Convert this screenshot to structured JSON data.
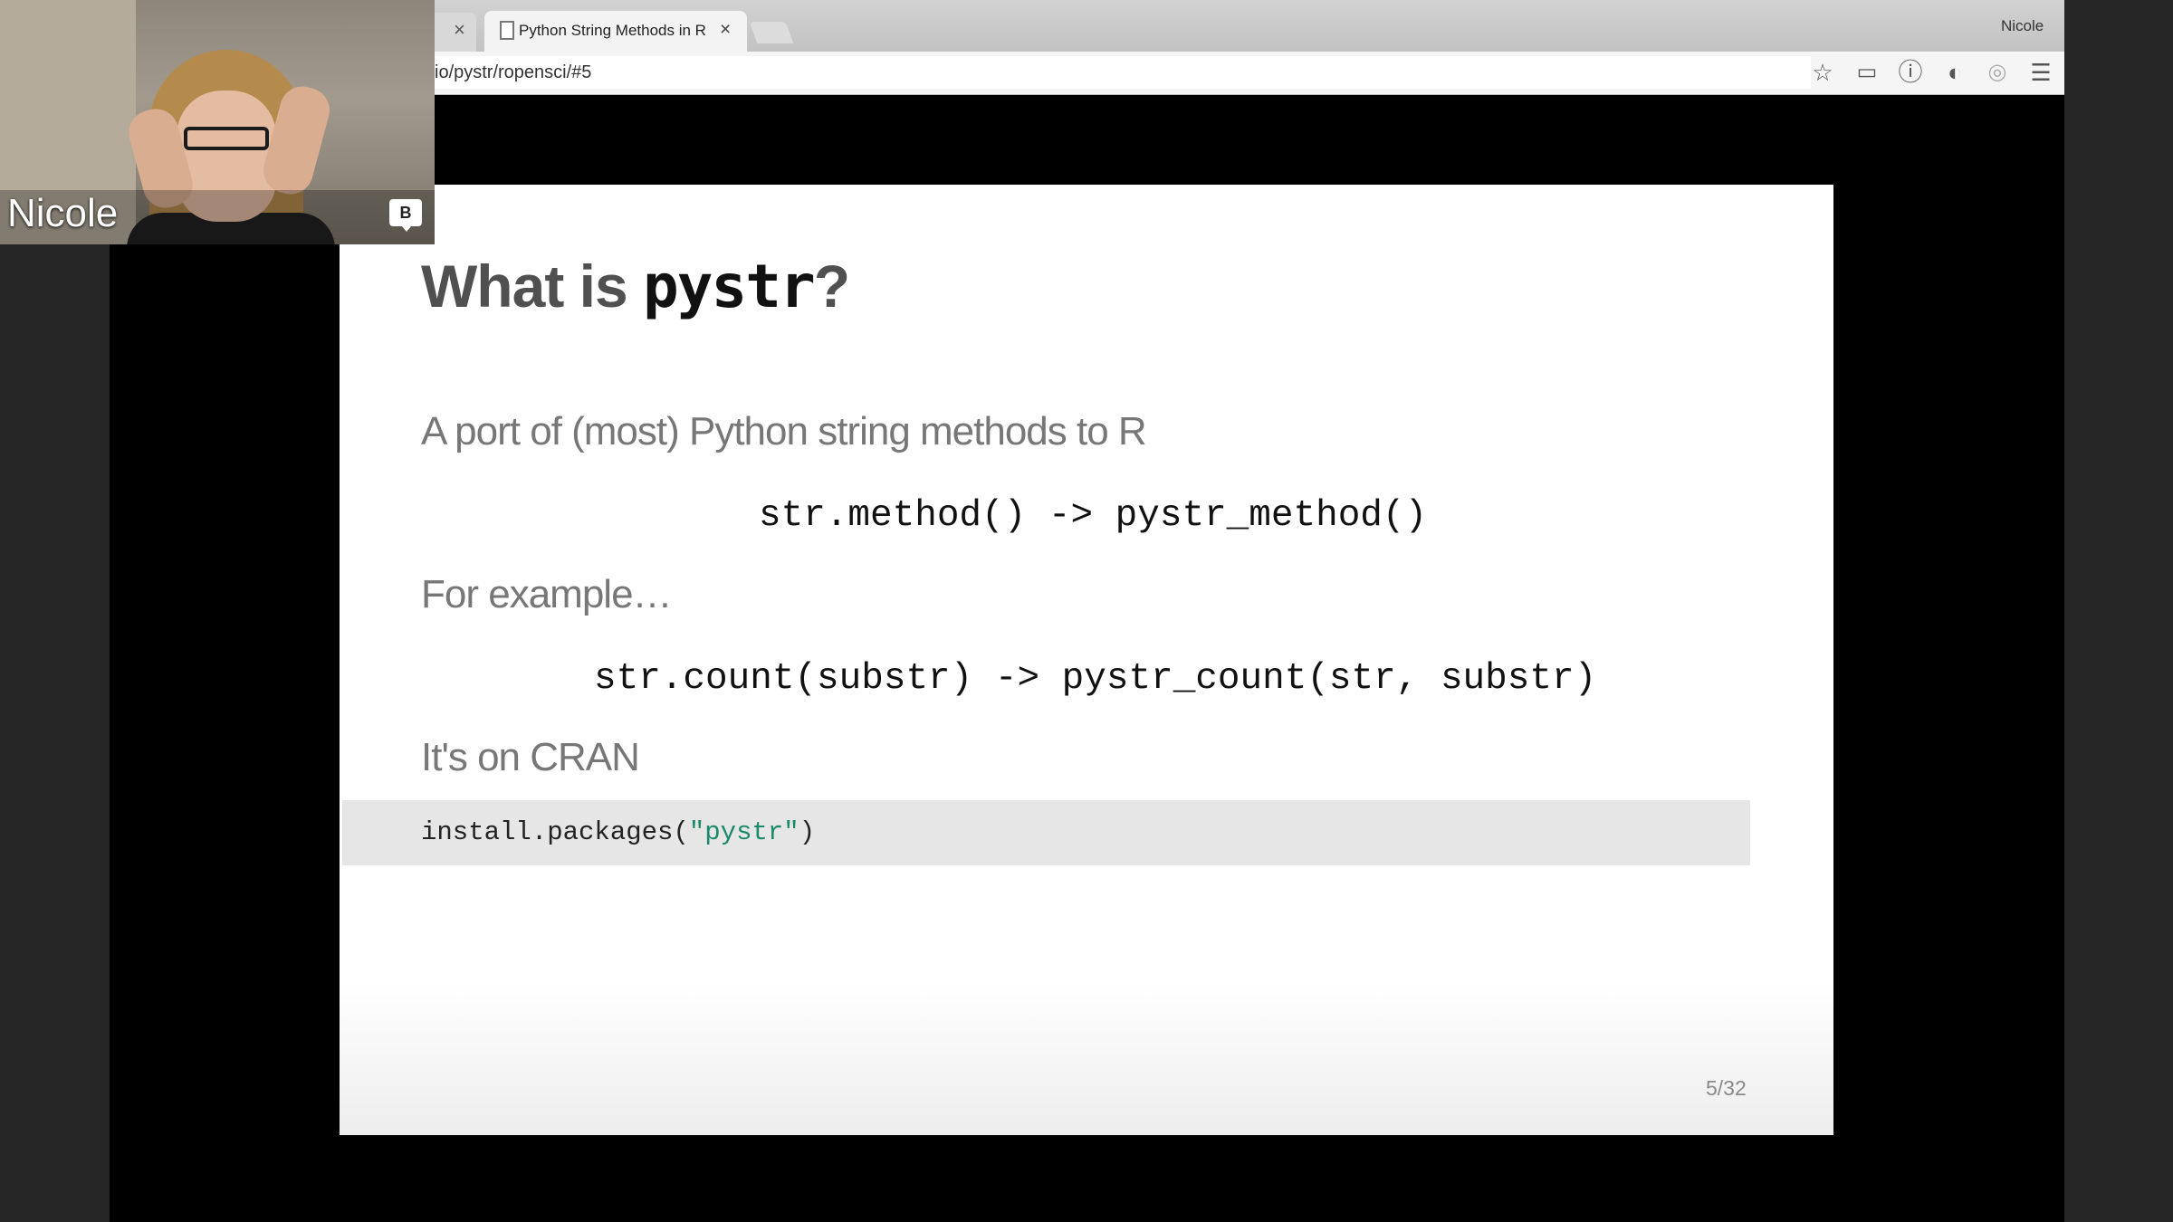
{
  "webcam": {
    "participant_name": "Nicole",
    "badge": "B"
  },
  "browser": {
    "active_tab_title": "Python String Methods in R",
    "profile_name": "Nicole",
    "url": "io/pystr/ropensci/#5",
    "icons": [
      "star-icon",
      "cast-icon",
      "info-icon",
      "extension-icon",
      "camera-icon",
      "menu-icon"
    ]
  },
  "slide": {
    "title_prefix": "What is ",
    "title_code": "pystr",
    "title_suffix": "?",
    "line1": "A port of (most) Python string methods to R",
    "code1": "str.method() -> pystr_method()",
    "line2": "For example…",
    "code2": "str.count(substr) -> pystr_count(str, substr)",
    "line3": "It's on CRAN",
    "install_fn": "install.packages(",
    "install_arg": "\"pystr\"",
    "install_close": ")",
    "page_number": "5/32"
  }
}
